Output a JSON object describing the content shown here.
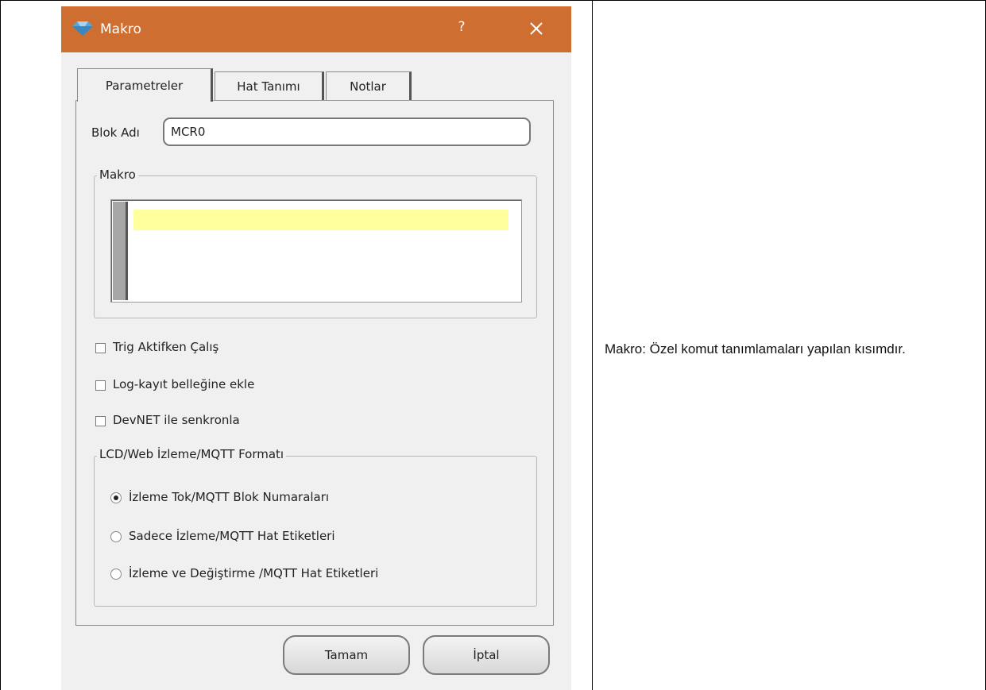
{
  "dialog": {
    "title": "Makro",
    "help_label": "?",
    "close_label": "✕",
    "titlebar_color": "#cf6e31",
    "app_icon": "diamond-app-icon",
    "tabs": [
      "Parametreler",
      "Hat Tanımı",
      "Notlar"
    ],
    "active_tab": "Parametreler",
    "block_name_label": "Blok Adı",
    "block_name_value": "MCR0",
    "macro_group_label": "Makro",
    "macro_editor_highlight_color": "#ffff9e",
    "checkboxes": [
      {
        "label": "Trig Aktifken Çalış",
        "checked": false
      },
      {
        "label": "Log-kayıt belleğine ekle",
        "checked": false
      },
      {
        "label": "DevNET ile senkronla",
        "checked": false
      }
    ],
    "format_group_label": "LCD/Web İzleme/MQTT Formatı",
    "radios": [
      {
        "label": "İzleme Tok/MQTT Blok Numaraları",
        "selected": true
      },
      {
        "label": "Sadece İzleme/MQTT Hat Etiketleri",
        "selected": false
      },
      {
        "label": "İzleme ve Değiştirme /MQTT Hat Etiketleri",
        "selected": false
      }
    ],
    "ok_label": "Tamam",
    "cancel_label": "İptal"
  },
  "description": {
    "text": "Makro:  Özel komut tanımlamaları yapılan kısımdır."
  }
}
